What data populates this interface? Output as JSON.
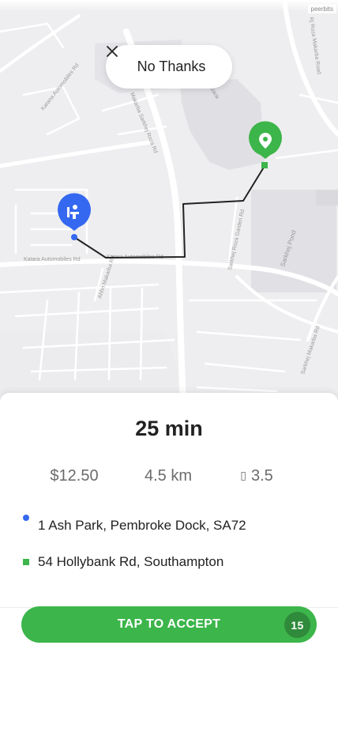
{
  "map": {
    "credit": "peerbits",
    "street_labels": [
      "Katana Automobiles Rd",
      "Makarba Sarkhej Roza Rd",
      "Bank",
      "Katara Automobiles Rd",
      "Katara Automobiles Rd",
      "Ahhn Makarba Rd",
      "Sarkhej Roza Garden Rd",
      "Sarkhej Pond",
      "Sarkhej Makarba Rd",
      "Rj Roza Makarba Road"
    ],
    "origin_marker_icon": "person-icon",
    "destination_marker_icon": "location-pin-icon",
    "colors": {
      "route": "#222222",
      "origin": "#3568f0",
      "destination": "#3cb54a"
    }
  },
  "dismiss": {
    "icon": "close-icon",
    "label": "No Thanks"
  },
  "trip": {
    "duration": "25 min",
    "price": "$12.50",
    "distance": "4.5 km",
    "rating_icon": "star-icon",
    "rating": "3.5",
    "pickup": "1 Ash Park, Pembroke Dock, SA72",
    "dropoff": "54 Hollybank Rd, Southampton"
  },
  "accept": {
    "label": "TAP TO ACCEPT",
    "countdown": "15"
  },
  "colors": {
    "accent": "#3cb54a",
    "accent_dark": "#2f8a3b",
    "pickup": "#3568f0"
  }
}
